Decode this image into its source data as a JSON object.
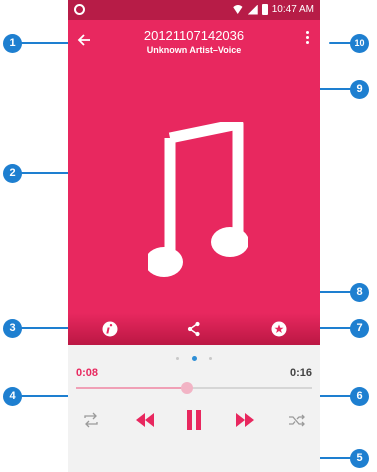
{
  "status_bar": {
    "time": "10:47 AM"
  },
  "track": {
    "title": "20121107142036",
    "subtitle": "Unknown Artist–Voice"
  },
  "playback": {
    "current_time": "0:08",
    "total_time": "0:16",
    "progress": 0.47,
    "pages": 3,
    "active_page": 1
  },
  "colors": {
    "accent": "#e8285f",
    "status_bar": "#b71c47",
    "callout": "#1e7fd0"
  },
  "icons": {
    "back": "arrow-left-icon",
    "menu": "more-vertical-icon",
    "album_art": "music-note-icon",
    "info": "info-icon",
    "share": "share-icon",
    "favorite": "star-icon",
    "repeat": "repeat-icon",
    "rewind": "rewind-icon",
    "pause": "pause-icon",
    "fast_forward": "fast-forward-icon",
    "shuffle": "shuffle-icon"
  },
  "callouts": [
    "1",
    "2",
    "3",
    "4",
    "5",
    "6",
    "7",
    "8",
    "9",
    "10"
  ]
}
